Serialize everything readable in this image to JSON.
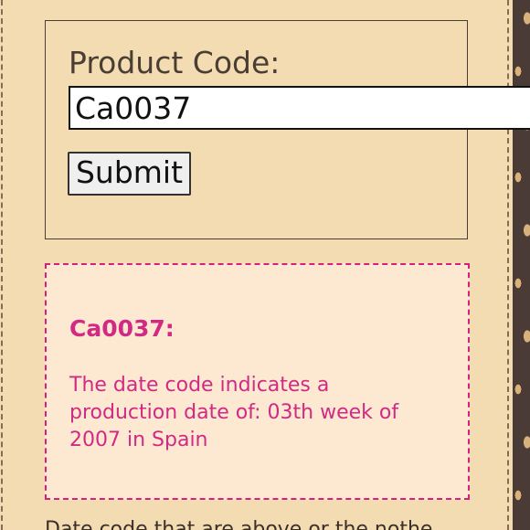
{
  "form": {
    "label": "Product Code:",
    "input_value": "Ca0037",
    "submit_label": "Submit"
  },
  "result": {
    "code_heading": "Ca0037:",
    "message": "The date code indicates a production date of: 03th week of 2007 in Spain"
  },
  "footer": {
    "partial_text": "Date code that are above or the nothe"
  },
  "colors": {
    "page_bg": "#f3dcb2",
    "result_bg": "#fde8d1",
    "accent_pink": "#d81f80",
    "text_dark": "#4a3d33"
  }
}
